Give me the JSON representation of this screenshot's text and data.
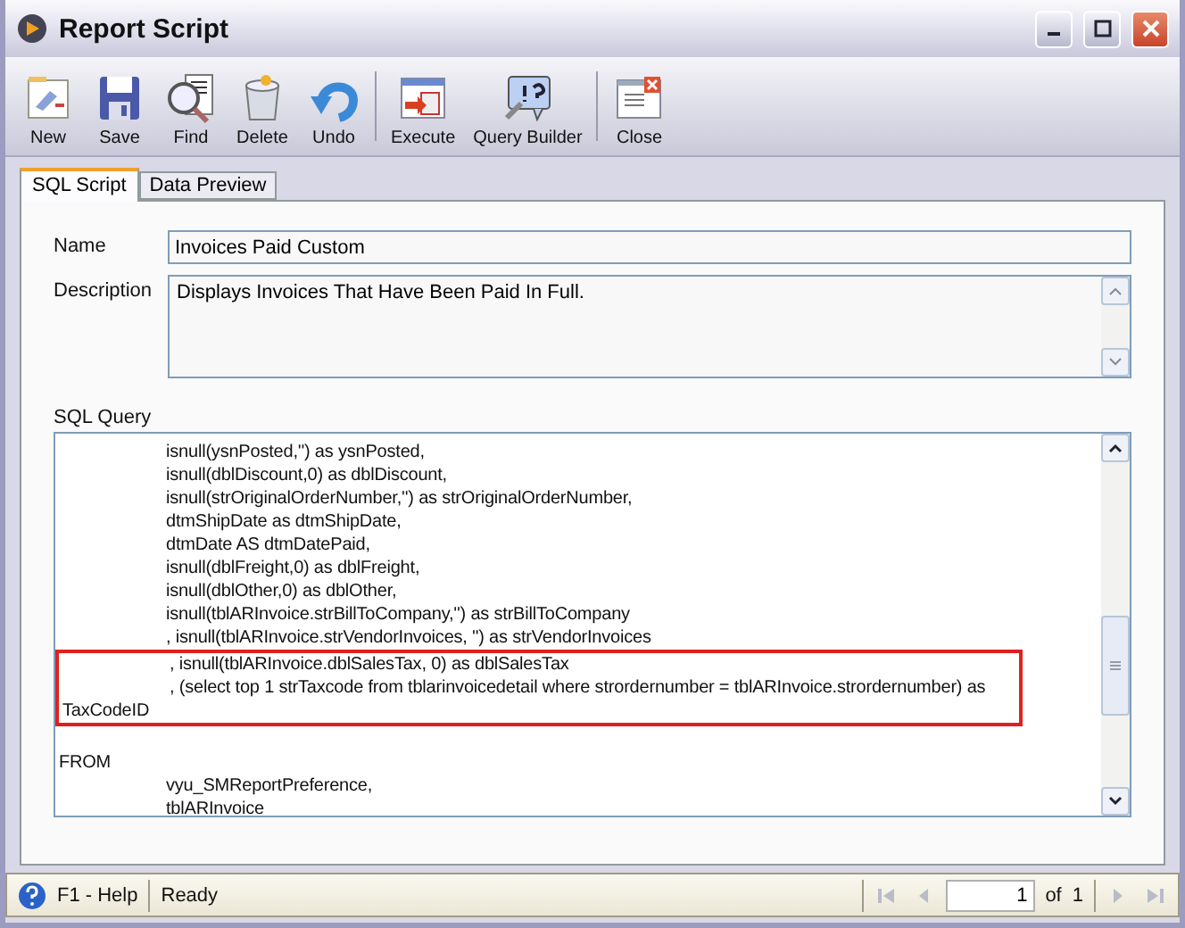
{
  "window": {
    "title": "Report Script"
  },
  "toolbar": [
    {
      "label": "New"
    },
    {
      "label": "Save"
    },
    {
      "label": "Find"
    },
    {
      "label": "Delete"
    },
    {
      "label": "Undo"
    },
    {
      "label": "Execute"
    },
    {
      "label": "Query Builder"
    },
    {
      "label": "Close"
    }
  ],
  "tabs": [
    {
      "label": "SQL Script",
      "selected": true
    },
    {
      "label": "Data Preview",
      "selected": false
    }
  ],
  "form": {
    "name_label": "Name",
    "name_value": "Invoices Paid Custom",
    "description_label": "Description",
    "description_value": "Displays Invoices That Have Been Paid In Full.",
    "query_label": "SQL Query"
  },
  "sql_lines": [
    {
      "text": "isnull(ysnPosted,'') as ysnPosted,",
      "indented": true,
      "highlighted": false
    },
    {
      "text": "isnull(dblDiscount,0) as dblDiscount,",
      "indented": true,
      "highlighted": false
    },
    {
      "text": "isnull(strOriginalOrderNumber,'') as strOriginalOrderNumber,",
      "indented": true,
      "highlighted": false
    },
    {
      "text": "dtmShipDate as dtmShipDate,",
      "indented": true,
      "highlighted": false
    },
    {
      "text": "dtmDate AS dtmDatePaid,",
      "indented": true,
      "highlighted": false
    },
    {
      "text": "isnull(dblFreight,0) as dblFreight,",
      "indented": true,
      "highlighted": false
    },
    {
      "text": "isnull(dblOther,0) as dblOther,",
      "indented": true,
      "highlighted": false
    },
    {
      "text": "isnull(tblARInvoice.strBillToCompany,'') as strBillToCompany",
      "indented": true,
      "highlighted": false
    },
    {
      "text": ", isnull(tblARInvoice.strVendorInvoices, '') as strVendorInvoices",
      "indented": true,
      "highlighted": false
    },
    {
      "text": ", isnull(tblARInvoice.dblSalesTax, 0) as dblSalesTax",
      "indented": true,
      "highlighted": true
    },
    {
      "text": ", (select top 1 strTaxcode from tblarinvoicedetail where strordernumber = tblARInvoice.strordernumber) as",
      "indented": true,
      "highlighted": true
    },
    {
      "text": "TaxCodeID",
      "indented": false,
      "highlighted": true
    },
    {
      "text": "FROM",
      "indented": false,
      "highlighted": false
    },
    {
      "text": "vyu_SMReportPreference,",
      "indented": true,
      "highlighted": false
    },
    {
      "text": "tblARInvoice",
      "indented": true,
      "highlighted": false
    }
  ],
  "status_bar": {
    "help": "F1 - Help",
    "status": "Ready",
    "page": "1",
    "of_label": "of",
    "page_count": "1"
  }
}
